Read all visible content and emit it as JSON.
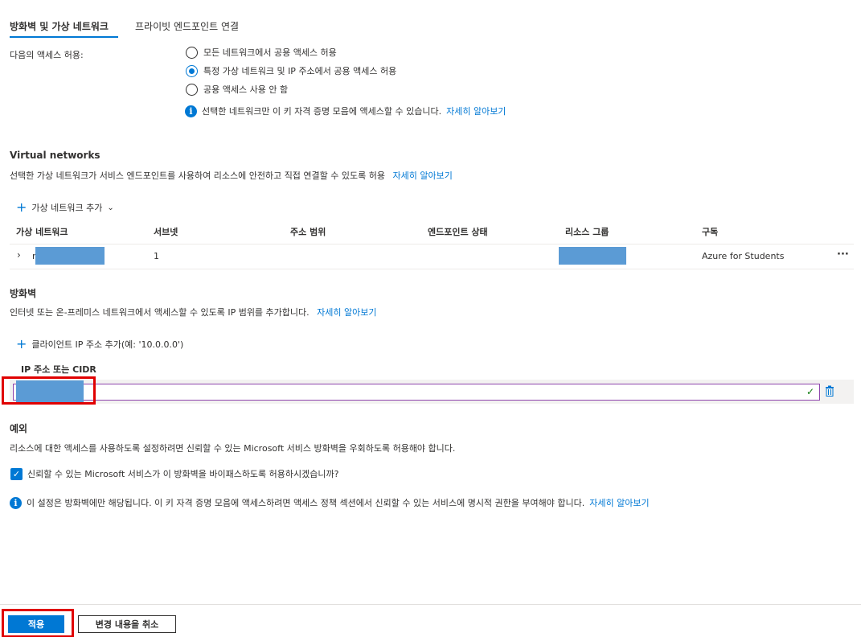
{
  "tabs": {
    "active": "방화벽 및 가상 네트워크",
    "second": "프라이빗 엔드포인트 연결"
  },
  "access": {
    "label": "다음의 액세스 허용:",
    "options": [
      "모든 네트워크에서 공용 액세스 허용",
      "특정 가상 네트워크 및 IP 주소에서 공용 액세스 허용",
      "공용 액세스 사용 안 함"
    ],
    "selected_index": 1,
    "info_text": "선택한 네트워크만 이 키 자격 증명 모음에 액세스할 수 있습니다.",
    "info_link": "자세히 알아보기"
  },
  "vnet": {
    "title": "Virtual networks",
    "desc": "선택한 가상 네트워크가 서비스 엔드포인트를 사용하여 리소스에 안전하고 직접 연결할 수 있도록 허용",
    "desc_link": "자세히 알아보기",
    "add_label": "가상 네트워크 추가",
    "columns": [
      "가상 네트워크",
      "서브넷",
      "주소 범위",
      "엔드포인트 상태",
      "리소스 그룹",
      "구독"
    ],
    "row": {
      "name_prefix": "r",
      "subnet": "1",
      "subscription": "Azure for Students",
      "more": "···"
    }
  },
  "firewall": {
    "title": "방화벽",
    "desc": "인터넷 또는 온-프레미스 네트워크에서 액세스할 수 있도록 IP 범위를 추가합니다.",
    "desc_link": "자세히 알아보기",
    "add_label": "클라이언트 IP 주소 추가(예: '10.0.0.0')",
    "column": "IP 주소 또는 CIDR"
  },
  "exceptions": {
    "title": "예외",
    "desc": "리소스에 대한 액세스를 사용하도록 설정하려면 신뢰할 수 있는 Microsoft 서비스 방화벽을 우회하도록 허용해야 합니다.",
    "checkbox_label": "신뢰할 수 있는 Microsoft 서비스가 이 방화벽을 바이패스하도록 허용하시겠습니까?",
    "info_text": "이 설정은 방화벽에만 해당됩니다. 이 키 자격 증명 모음에 액세스하려면 액세스 정책 섹션에서 신뢰할 수 있는 서비스에 명시적 권한을 부여해야 합니다.",
    "info_link": "자세히 알아보기"
  },
  "footer": {
    "apply": "적용",
    "discard": "변경 내용을 취소"
  },
  "colors": {
    "accent": "#0078d4",
    "highlight_red": "#e00000",
    "redaction": "#5b9bd5"
  }
}
